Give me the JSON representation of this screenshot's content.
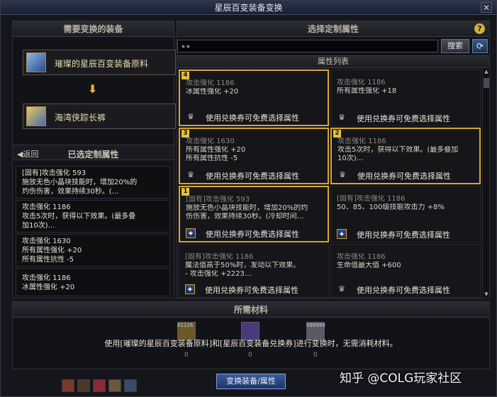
{
  "window": {
    "title": "星辰百变装备变换",
    "close_glyph": "✕"
  },
  "left": {
    "header": "需要变换的装备",
    "source_item": {
      "name": "璀璨的星辰百变装备原料",
      "icon": "crystal-icon"
    },
    "target_item": {
      "name": "海湾侠踪长裤",
      "icon": "pants-icon"
    },
    "back_label": "返回",
    "back_glyph": "◀",
    "selected_title": "已选定制属性",
    "selected": [
      {
        "lines": [
          "[固有]攻击强化 593",
          "施放无色小晶块技能时，增加20%的",
          "灼伤伤害，效果持续30秒。(…"
        ]
      },
      {
        "lines": [
          "攻击强化 1186",
          "攻击5次时，获得以下效果。(最多叠",
          "加10次)…"
        ]
      },
      {
        "lines": [
          "攻击强化 1630",
          "所有属性强化 +20",
          "所有属性抗性 -5"
        ]
      },
      {
        "lines": [
          "攻击强化 1186",
          "冰属性强化 +20"
        ]
      }
    ]
  },
  "right": {
    "header": "选择定制属性",
    "help_glyph": "?",
    "search_value": "∘∘",
    "search_label": "搜索",
    "refresh_glyph": "⟳",
    "list_title": "属性列表",
    "cards": [
      {
        "badge": "4",
        "selected": true,
        "lines": [
          "攻击强化 1186",
          "冰属性强化 +20"
        ],
        "foot": "使用兑换券可免费选择属性",
        "icon": "grey"
      },
      {
        "badge": "",
        "selected": false,
        "lines": [
          "攻击强化 1186",
          "所有属性强化 +18"
        ],
        "foot": "使用兑换券可免费选择属性",
        "icon": "grey"
      },
      {
        "badge": "3",
        "selected": true,
        "lines": [
          "攻击强化 1630",
          "所有属性强化 +20",
          "所有属性抗性 -5"
        ],
        "foot": "使用兑换券可免费选择属性",
        "icon": "grey"
      },
      {
        "badge": "2",
        "selected": true,
        "lines": [
          "攻击强化 1186",
          "攻击5次时，获得以下效果。(最多叠加",
          "10次)…"
        ],
        "foot": "使用兑换券可免费选择属性",
        "icon": "grey"
      },
      {
        "badge": "1",
        "selected": true,
        "lines": [
          "[固有]攻击强化 593",
          "施放无色小晶块技能时，增加20%的灼",
          "伤伤害，效果持续30秒。(冷却时间…"
        ],
        "foot": "使用兑换券可免费选择属性",
        "icon": "blue"
      },
      {
        "badge": "",
        "selected": false,
        "lines": [
          "[固有]攻击强化 1186",
          "50、85、100级技能攻击力 +8%"
        ],
        "foot": "使用兑换券可免费选择属性",
        "icon": "blue"
      },
      {
        "badge": "",
        "selected": false,
        "lines": [
          "[固有]攻击强化 1186",
          "魔法值高于50%时，发动以下效果。",
          "- 攻击强化 +2223…"
        ],
        "foot": "使用兑换券可免费选择属性",
        "icon": "blue"
      },
      {
        "badge": "",
        "selected": false,
        "lines": [
          "攻击强化 1186",
          "生命值最大值 +600"
        ],
        "foot": "使用兑换券可免费选择属性",
        "icon": "grey"
      }
    ]
  },
  "materials": {
    "header": "所需材料",
    "items": [
      {
        "count": "81126",
        "qty": "0",
        "color": "#6a5a2a"
      },
      {
        "count": "",
        "qty": "0",
        "color": "#4a3a7a"
      },
      {
        "count": "999999",
        "qty": "0",
        "color": "#5a5a66"
      }
    ],
    "message": "使用[璀璨的星辰百变装备原料]和[星辰百变装备兑换券]进行变换时，无需消耗材料。"
  },
  "footer": {
    "exchange_label": "变换装备/属性",
    "watermark": "知乎 @COLG玩家社区"
  },
  "colors": {
    "accent_gold": "#d6a632",
    "panel_bg": "#121318",
    "badge": "#e6c23a"
  }
}
